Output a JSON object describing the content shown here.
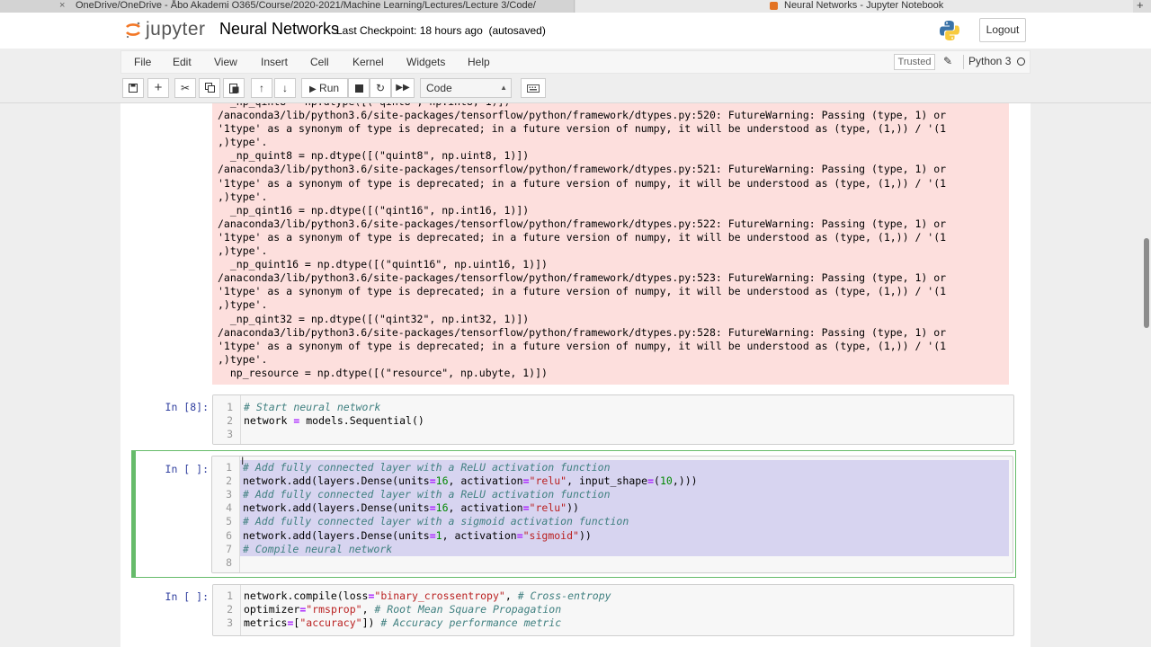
{
  "browser": {
    "tabs": [
      {
        "title": "OneDrive/OneDrive - Åbo Akademi O365/Course/2020-2021/Machine Learning/Lectures/Lecture 3/Code/",
        "close": "×"
      },
      {
        "title": "Neural Networks - Jupyter Notebook"
      }
    ],
    "new_tab": "+"
  },
  "header": {
    "logo_text": "jupyter",
    "notebook_name": "Neural Networks",
    "checkpoint": "Last Checkpoint: 18 hours ago",
    "autosave": "(autosaved)",
    "logout": "Logout"
  },
  "menu": {
    "items": [
      "File",
      "Edit",
      "View",
      "Insert",
      "Cell",
      "Kernel",
      "Widgets",
      "Help"
    ],
    "trusted": "Trusted",
    "kernel": "Python 3"
  },
  "toolbar": {
    "save_icon": "save-icon",
    "add_icon": "plus-icon",
    "run_label": "Run",
    "cell_type": "Code"
  },
  "output": {
    "warning_text": "  _np_qint8 = np.dtype([(\"qint8\", np.int8, 1)])\n/anaconda3/lib/python3.6/site-packages/tensorflow/python/framework/dtypes.py:520: FutureWarning: Passing (type, 1) or\n'1type' as a synonym of type is deprecated; in a future version of numpy, it will be understood as (type, (1,)) / '(1\n,)type'.\n  _np_quint8 = np.dtype([(\"quint8\", np.uint8, 1)])\n/anaconda3/lib/python3.6/site-packages/tensorflow/python/framework/dtypes.py:521: FutureWarning: Passing (type, 1) or\n'1type' as a synonym of type is deprecated; in a future version of numpy, it will be understood as (type, (1,)) / '(1\n,)type'.\n  _np_qint16 = np.dtype([(\"qint16\", np.int16, 1)])\n/anaconda3/lib/python3.6/site-packages/tensorflow/python/framework/dtypes.py:522: FutureWarning: Passing (type, 1) or\n'1type' as a synonym of type is deprecated; in a future version of numpy, it will be understood as (type, (1,)) / '(1\n,)type'.\n  _np_quint16 = np.dtype([(\"quint16\", np.uint16, 1)])\n/anaconda3/lib/python3.6/site-packages/tensorflow/python/framework/dtypes.py:523: FutureWarning: Passing (type, 1) or\n'1type' as a synonym of type is deprecated; in a future version of numpy, it will be understood as (type, (1,)) / '(1\n,)type'.\n  _np_qint32 = np.dtype([(\"qint32\", np.int32, 1)])\n/anaconda3/lib/python3.6/site-packages/tensorflow/python/framework/dtypes.py:528: FutureWarning: Passing (type, 1) or\n'1type' as a synonym of type is deprecated; in a future version of numpy, it will be understood as (type, (1,)) / '(1\n,)type'.\n  np_resource = np.dtype([(\"resource\", np.ubyte, 1)])"
  },
  "cells": [
    {
      "prompt": "In [8]:",
      "lines": [
        [
          [
            "# Start neural network",
            "comment"
          ]
        ],
        [
          [
            "network ",
            ""
          ],
          [
            "=",
            "op"
          ],
          [
            " models.Sequential()",
            ""
          ]
        ],
        [
          [
            "",
            ""
          ]
        ]
      ]
    },
    {
      "prompt": "In [ ]:",
      "lines": [
        [
          [
            "# Add fully connected layer with a ReLU activation function",
            "comment"
          ]
        ],
        [
          [
            "network.add(layers.Dense(units",
            ""
          ],
          [
            "=",
            "op"
          ],
          [
            "16",
            "num"
          ],
          [
            ", activation",
            ""
          ],
          [
            "=",
            "op"
          ],
          [
            "\"relu\"",
            "str"
          ],
          [
            ", input_shape",
            ""
          ],
          [
            "=",
            "op"
          ],
          [
            "(",
            ""
          ],
          [
            "10",
            "num"
          ],
          [
            ",)))",
            ""
          ]
        ],
        [
          [
            "# Add fully connected layer with a ReLU activation function",
            "comment"
          ]
        ],
        [
          [
            "network.add(layers.Dense(units",
            ""
          ],
          [
            "=",
            "op"
          ],
          [
            "16",
            "num"
          ],
          [
            ", activation",
            ""
          ],
          [
            "=",
            "op"
          ],
          [
            "\"relu\"",
            "str"
          ],
          [
            "))",
            ""
          ]
        ],
        [
          [
            "# Add fully connected layer with a sigmoid activation function",
            "comment"
          ]
        ],
        [
          [
            "network.add(layers.Dense(units",
            ""
          ],
          [
            "=",
            "op"
          ],
          [
            "1",
            "num"
          ],
          [
            ", activation",
            ""
          ],
          [
            "=",
            "op"
          ],
          [
            "\"sigmoid\"",
            "str"
          ],
          [
            "))",
            ""
          ]
        ],
        [
          [
            "# Compile neural network",
            "comment"
          ]
        ],
        [
          [
            "",
            ""
          ]
        ]
      ]
    },
    {
      "prompt": "In [ ]:",
      "lines": [
        [
          [
            "network.compile(loss",
            ""
          ],
          [
            "=",
            "op"
          ],
          [
            "\"binary_crossentropy\"",
            "str"
          ],
          [
            ", ",
            ""
          ],
          [
            "# Cross-entropy",
            "comment"
          ]
        ],
        [
          [
            "optimizer",
            ""
          ],
          [
            "=",
            "op"
          ],
          [
            "\"rmsprop\"",
            "str"
          ],
          [
            ", ",
            ""
          ],
          [
            "# Root Mean Square Propagation",
            "comment"
          ]
        ],
        [
          [
            "metrics",
            ""
          ],
          [
            "=",
            "op"
          ],
          [
            "[",
            ""
          ],
          [
            "\"accuracy\"",
            "str"
          ],
          [
            "]) ",
            ""
          ],
          [
            "# Accuracy performance metric",
            "comment"
          ]
        ]
      ]
    }
  ],
  "colors": {
    "prompt": "#303f9f",
    "selected_cell_border": "#66bb6a",
    "error_output_bg": "#fddfdd",
    "selection": "#d7d4f0"
  }
}
